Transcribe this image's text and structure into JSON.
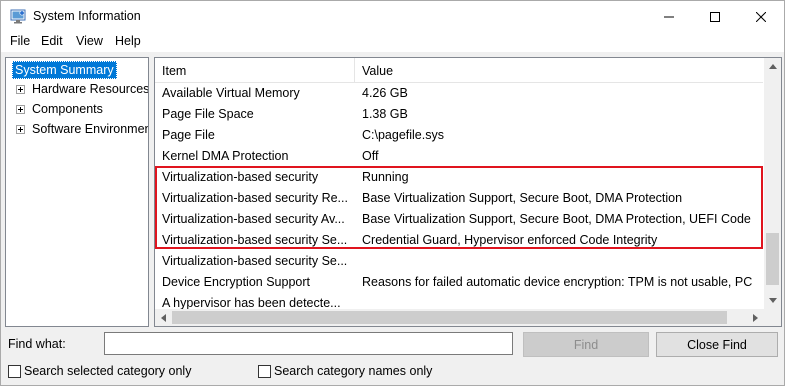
{
  "window": {
    "title": "System Information",
    "minimize_glyph": "—",
    "maximize_glyph": "☐",
    "close_glyph": "✕"
  },
  "menu": {
    "items": [
      "File",
      "Edit",
      "View",
      "Help"
    ]
  },
  "tree": {
    "selected": "System Summary",
    "items": [
      {
        "label": "Hardware Resources"
      },
      {
        "label": "Components"
      },
      {
        "label": "Software Environment"
      }
    ]
  },
  "list": {
    "columns": {
      "item": "Item",
      "value": "Value"
    },
    "rows": [
      {
        "item": "Available Virtual Memory",
        "value": "4.26 GB"
      },
      {
        "item": "Page File Space",
        "value": "1.38 GB"
      },
      {
        "item": "Page File",
        "value": "C:\\pagefile.sys"
      },
      {
        "item": "Kernel DMA Protection",
        "value": "Off"
      },
      {
        "item": "Virtualization-based security",
        "value": "Running"
      },
      {
        "item": "Virtualization-based security Re...",
        "value": "Base Virtualization Support, Secure Boot, DMA Protection"
      },
      {
        "item": "Virtualization-based security Av...",
        "value": "Base Virtualization Support, Secure Boot, DMA Protection, UEFI Code"
      },
      {
        "item": "Virtualization-based security Se...",
        "value": "Credential Guard, Hypervisor enforced Code Integrity"
      },
      {
        "item": "Virtualization-based security Se...",
        "value": ""
      },
      {
        "item": "Device Encryption Support",
        "value": "Reasons for failed automatic device encryption: TPM is not usable, PC"
      },
      {
        "item": "A hypervisor has been detecte...",
        "value": ""
      }
    ],
    "highlight_color": "#e0141e"
  },
  "find": {
    "label": "Find what:",
    "value": "",
    "find_button": "Find",
    "close_find_button": "Close Find",
    "search_selected_label": "Search selected category only",
    "search_names_label": "Search category names only"
  },
  "colors": {
    "selection": "#0078d7",
    "highlight": "#e0141e"
  }
}
